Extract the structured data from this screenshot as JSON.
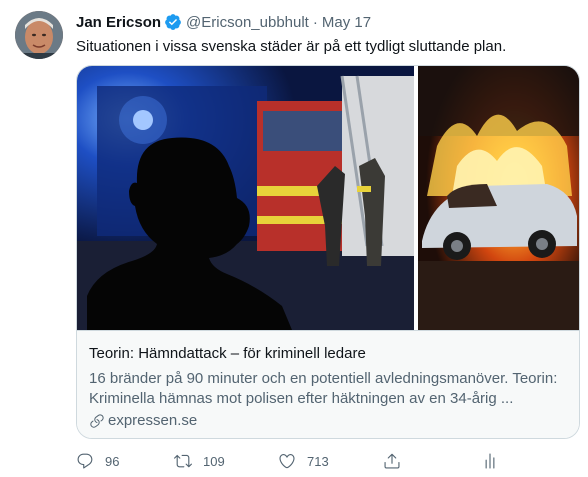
{
  "tweet": {
    "display_name": "Jan Ericson",
    "handle": "@Ericson_ubbhult",
    "separator": "·",
    "date": "May 17",
    "text": "Situationen i vissa svenska städer är på ett tydligt sluttande plan."
  },
  "card": {
    "title": "Teorin: Hämndattack – för kriminell ledare",
    "description_line1": "16 bränder på 90 minuter och en potentiell avledningsmanöver. Teorin:",
    "description_line2": "Kriminella hämnas mot polisen efter häktningen av en 34-årig ...",
    "domain": "expressen.se"
  },
  "actions": {
    "reply_count": "96",
    "retweet_count": "109",
    "like_count": "713"
  },
  "icons": {
    "verified": "verified-badge-icon",
    "link": "link-icon",
    "reply": "reply-icon",
    "retweet": "retweet-icon",
    "like": "heart-icon",
    "share": "share-icon",
    "analytics": "analytics-icon"
  },
  "colors": {
    "verified_blue": "#1d9bf0",
    "secondary_text": "#536471",
    "border": "#cfd9de"
  }
}
